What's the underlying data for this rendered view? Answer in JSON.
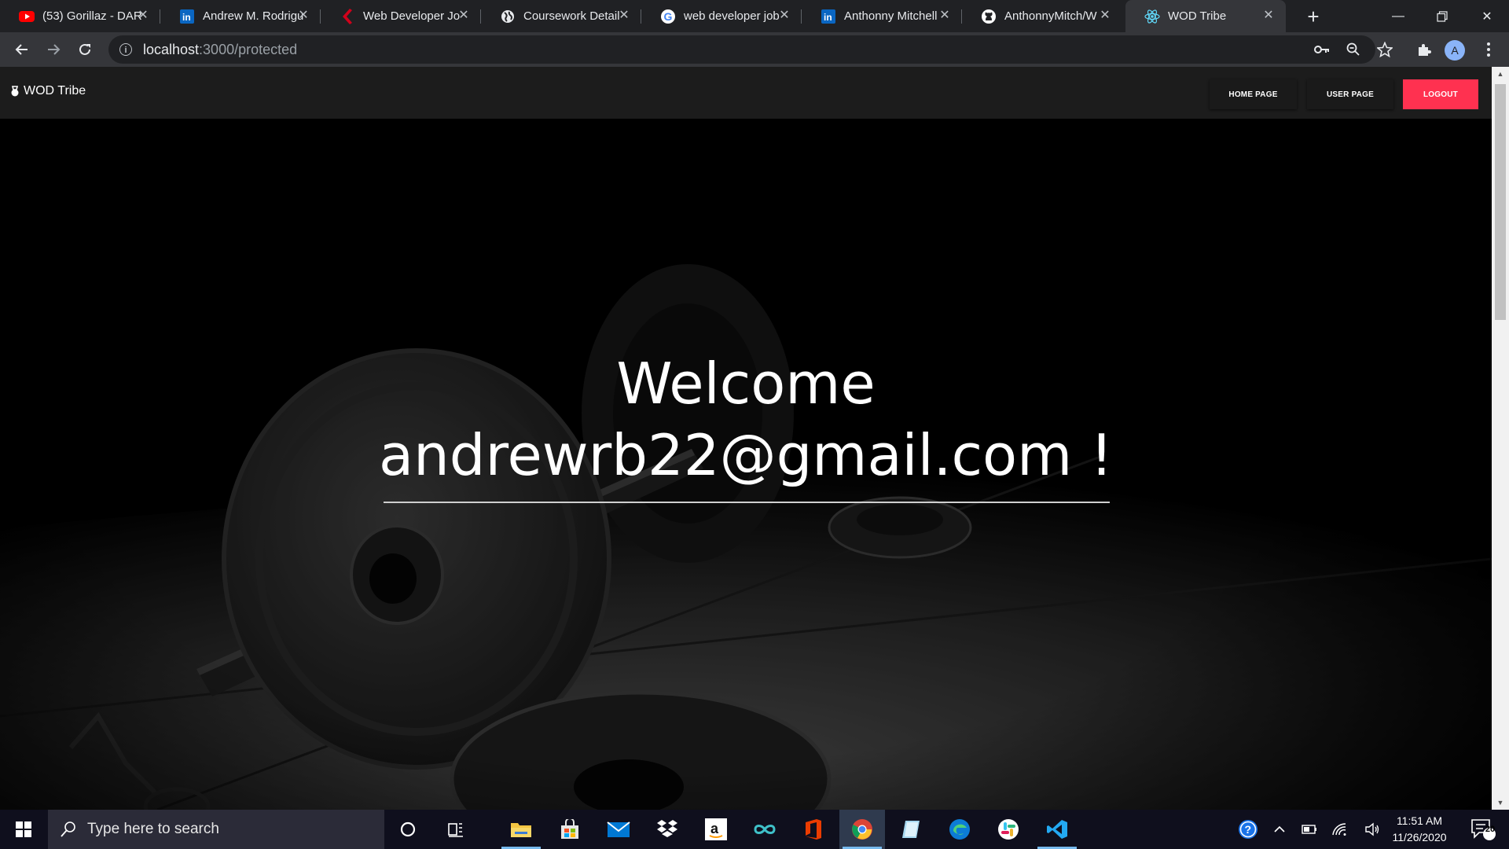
{
  "browser": {
    "tabs": [
      {
        "title": "(53) Gorillaz - DAR",
        "favicon": "youtube-icon",
        "color": "#ff0000"
      },
      {
        "title": "Andrew M. Rodrigu",
        "favicon": "linkedin-icon",
        "color": "#0a66c2"
      },
      {
        "title": "Web Developer Jo",
        "favicon": "indeed-icon",
        "color": "#d0021b"
      },
      {
        "title": "Coursework Detail",
        "favicon": "globe-icon",
        "color": "#e8eaed"
      },
      {
        "title": "web developer job",
        "favicon": "google-icon",
        "color": "#4285f4"
      },
      {
        "title": "Anthonny Mitchell",
        "favicon": "linkedin-icon",
        "color": "#0a66c2"
      },
      {
        "title": "AnthonnyMitch/W",
        "favicon": "github-icon",
        "color": "#ffffff"
      },
      {
        "title": "WOD Tribe",
        "favicon": "react-icon",
        "color": "#61dafb",
        "active": true
      }
    ],
    "url_host": "localhost",
    "url_path": ":3000/protected",
    "profile_initial": "A"
  },
  "navbar": {
    "brand": "WOD Tribe",
    "home_label": "HOME PAGE",
    "user_label": "USER PAGE",
    "logout_label": "LOGOUT",
    "logout_color": "#ff3150"
  },
  "hero": {
    "welcome_line1": "Welcome",
    "welcome_line2": "andrewrb22@gmail.com !"
  },
  "taskbar": {
    "search_placeholder": "Type here to search",
    "time": "11:51 AM",
    "date": "11/26/2020",
    "notification_count": "20",
    "apps": [
      "cortana-icon",
      "task-view-icon",
      "file-explorer-icon",
      "store-icon",
      "mail-icon",
      "dropbox-icon",
      "amazon-icon",
      "infinity-icon",
      "office-icon",
      "chrome-icon",
      "notes-icon",
      "edge-icon",
      "slack-icon",
      "vscode-icon"
    ]
  }
}
